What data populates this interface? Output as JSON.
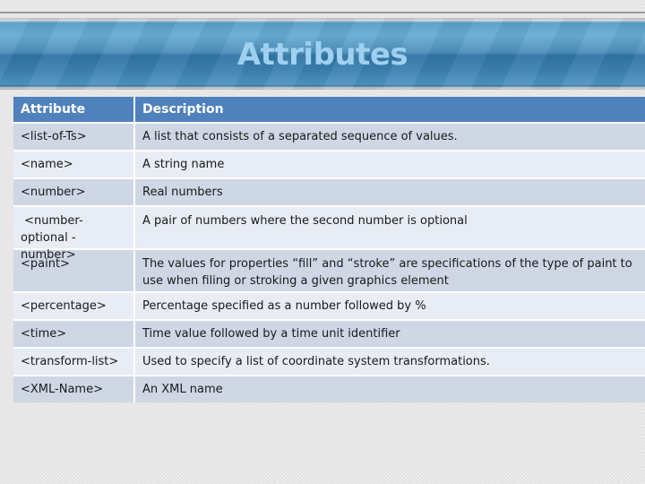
{
  "slide": {
    "title": "Attributes"
  },
  "table": {
    "headers": [
      "Attribute",
      "Description"
    ],
    "rows": [
      {
        "attribute": "<list-of-Ts>",
        "description": "A list that consists of a separated sequence of values."
      },
      {
        "attribute": "<name>",
        "description": "A string name"
      },
      {
        "attribute": "<number>",
        "description": "Real numbers"
      },
      {
        "attribute": " <number-optional -number>",
        "description": "A pair of numbers where the second number is optional"
      },
      {
        "attribute": "<paint>",
        "description": "The values for properties “fill” and “stroke” are specifications of the type of paint to use when filing or stroking a given graphics element"
      },
      {
        "attribute": "<percentage>",
        "description": "Percentage specified as a number followed by %"
      },
      {
        "attribute": "<time>",
        "description": "Time value followed by a time unit identifier"
      },
      {
        "attribute": "<transform-list>",
        "description": "Used to specify a list of coordinate system transformations."
      },
      {
        "attribute": "<XML-Name>",
        "description": "An XML name"
      }
    ]
  },
  "colors": {
    "header_bg": "#4f81bd",
    "row_odd_bg": "#cfd7e5",
    "row_even_bg": "#e8ecf4",
    "title_text": "#9fd0ef"
  }
}
